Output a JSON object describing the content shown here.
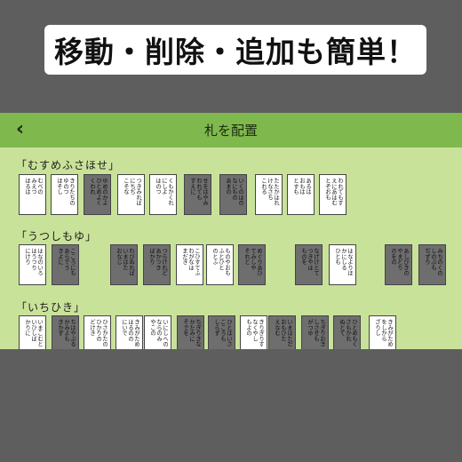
{
  "banner": {
    "text": "移動・削除・追加も簡単！"
  },
  "appbar": {
    "back_icon": "‹",
    "title": "札を配置"
  },
  "groups": [
    {
      "title": "「むすめふさほせ」",
      "cards": [
        {
          "text": "むべの\nみえつ\nほるは",
          "g": false
        },
        {
          "text": "きりたちの\nゆのつ\nほそし",
          "g": false
        },
        {
          "text": "ゆめのかよ\nひとめよく\nくわれ",
          "g": true
        },
        {
          "text": "つきみれば\nにちぢ\nこそな",
          "g": false
        },
        {
          "text": "くもかくれ\nにしよ\nはのつ",
          "g": false
        },
        {
          "text": "せをはやみ\nわれても\nすえに",
          "g": true
        },
        {
          "text": "いくのはの\nなにもの\nあまの",
          "g": true
        },
        {
          "text": "たたかはれ\nけなさち\nこれる",
          "g": false
        },
        {
          "text": "あるは\nおもは\nとすも",
          "g": false
        },
        {
          "text": "われてもす\nえにあはむ\nとぞおも",
          "g": false
        }
      ]
    },
    {
      "title": "「うつしもゆ」",
      "cards": [
        {
          "text": "はなのいろ\nはうつり\nにけり",
          "g": false
        },
        {
          "text": "こころにも\nあらでう\nきよに",
          "g": true
        },
        {
          "text": "わびぬれば\nいまはた\nおなじ",
          "g": true
        },
        {
          "text": "つらけれど\nあかつき\nばかり",
          "g": true
        },
        {
          "text": "こひすてふ\nわがなは\nまだき",
          "g": false
        },
        {
          "text": "ものやおも\nふとひと\nのとふ",
          "g": false
        },
        {
          "text": "めぐりあひ\nてみしや\nそれと",
          "g": true
        },
        {
          "text": "なげけとて\nつきやは\nものを",
          "g": true
        },
        {
          "text": "はなよりほ\nかにしる\nひとも",
          "g": false
        },
        {
          "text": "あしびきの\nやまどり\nのをの",
          "g": true
        },
        {
          "text": "みちのくの\nしのぶも\nぢずり",
          "g": true
        }
      ]
    },
    {
      "title": "「いちひき」",
      "cards": [
        {
          "text": "いまこむと\nいひしば\nかりに",
          "g": false
        },
        {
          "text": "ちはやぶる\nかみよも\nきかず",
          "g": true
        },
        {
          "text": "ひさかたの\nひかりの\nどけき",
          "g": false
        },
        {
          "text": "きみがため\nはるのの\nにいで",
          "g": false
        },
        {
          "text": "いにしへの\nならのみ\nやこの",
          "g": false
        },
        {
          "text": "ちぎりきな\nかたみに\nそでを",
          "g": true
        },
        {
          "text": "ひとはいさ\nこころも\nしらず",
          "g": true
        },
        {
          "text": "きりぎりす\nなくやし\nもよの",
          "g": false
        },
        {
          "text": "いまはただ\nおもひた\nえなむ",
          "g": true
        },
        {
          "text": "ちぎりおき\nしさせも\nがつゆ",
          "g": true
        },
        {
          "text": "ひとめもく\nさもかれ\nぬとて",
          "g": true
        },
        {
          "text": "きみがため\nをしから\nざりし",
          "g": false
        }
      ]
    }
  ]
}
